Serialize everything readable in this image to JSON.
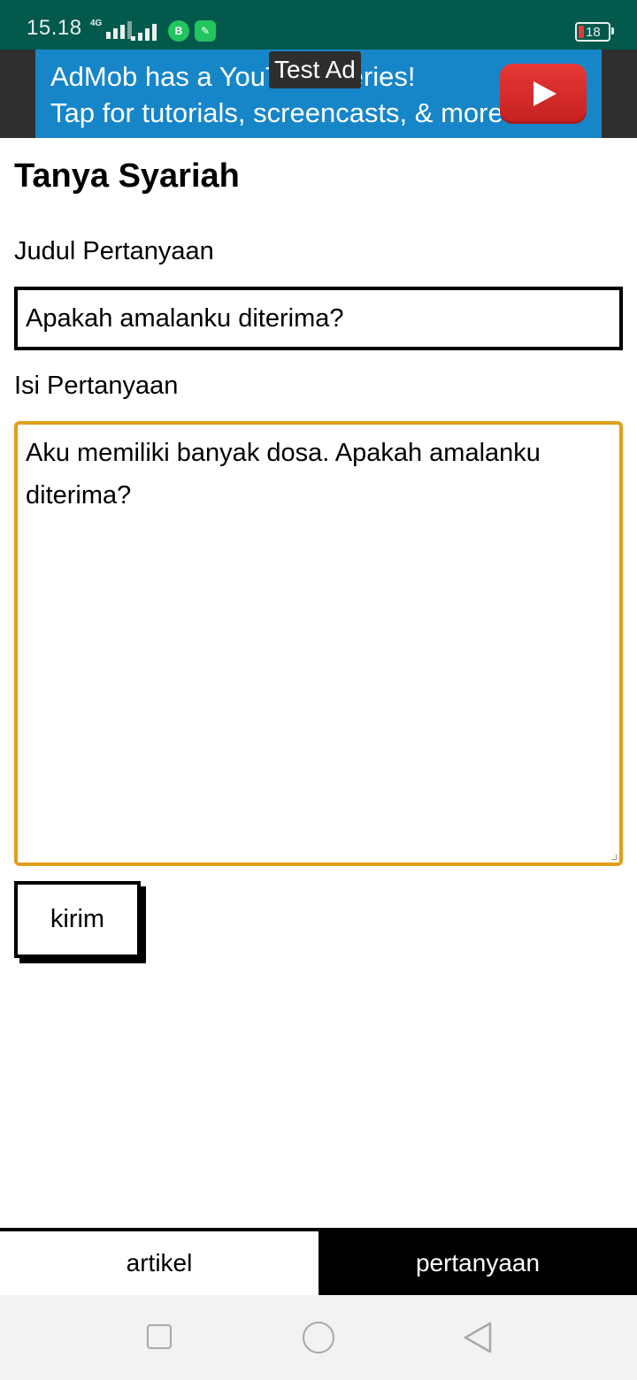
{
  "status_bar": {
    "time": "15.18",
    "network": "4G",
    "battery": "18",
    "background_color": "#03594b",
    "icons": [
      "signal-4g-icon",
      "signal-icon",
      "whatsapp-business-icon",
      "app-notification-icon",
      "battery-icon"
    ]
  },
  "ad": {
    "line1": "AdMob has a YouTube series!",
    "line2": "Tap for tutorials, screencasts, & more.",
    "badge": "Test Ad",
    "background_color": "#1686c9",
    "icon": "youtube-play-icon"
  },
  "form": {
    "title": "Tanya Syariah",
    "judul_label": "Judul Pertanyaan",
    "judul_value": "Apakah amalanku diterima?",
    "isi_label": "Isi Pertanyaan",
    "isi_value": "Aku memiliki banyak dosa. Apakah amalanku diterima?",
    "submit_label": "kirim",
    "focus_color": "#e0a01c"
  },
  "bottom_nav": {
    "tabs": [
      {
        "label": "artikel",
        "active": false
      },
      {
        "label": "pertanyaan",
        "active": true
      }
    ]
  },
  "system_nav": {
    "icons": [
      "recent-apps-icon",
      "home-icon",
      "back-icon"
    ]
  }
}
